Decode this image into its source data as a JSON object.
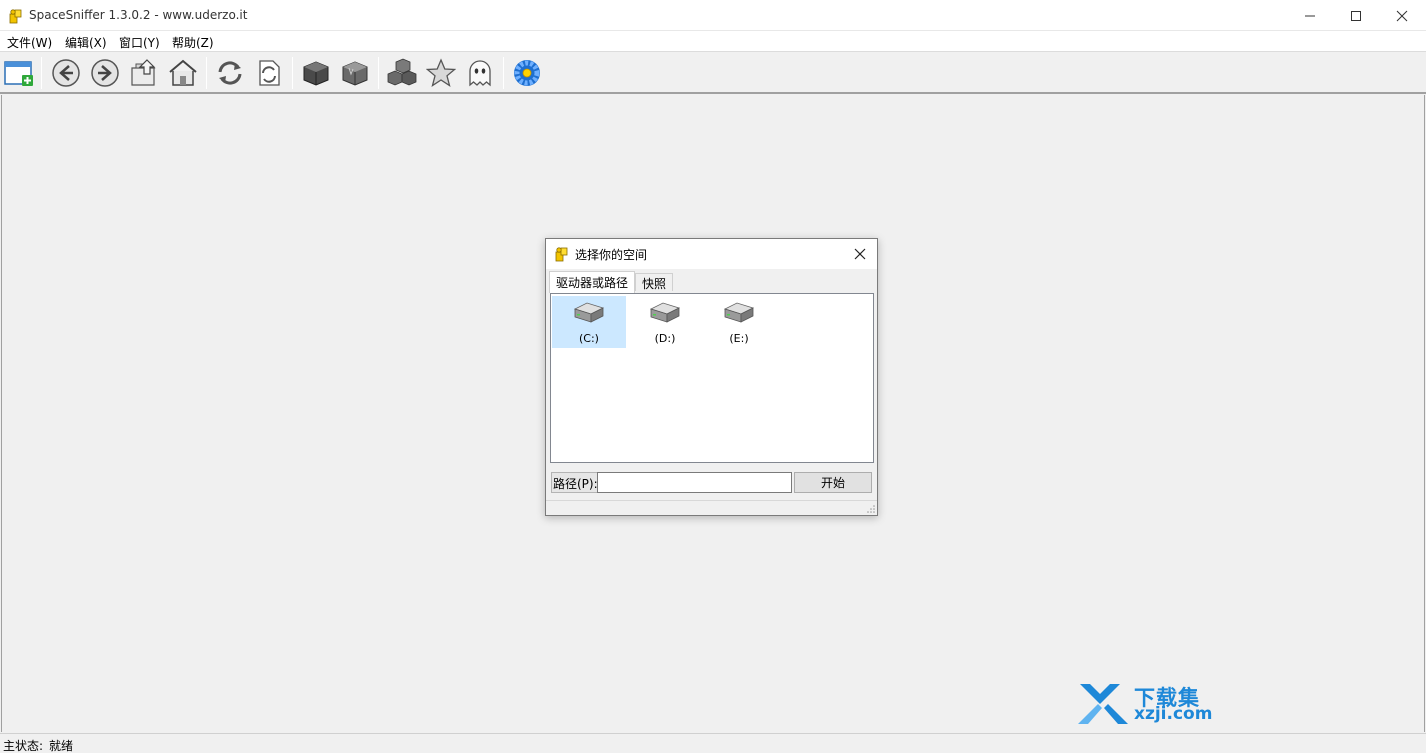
{
  "window": {
    "title": "SpaceSniffer 1.3.0.2 - www.uderzo.it",
    "min_glyph": "—",
    "close_glyph": "✕"
  },
  "menu": [
    {
      "label": "文件(W)"
    },
    {
      "label": "编辑(X)"
    },
    {
      "label": "窗口(Y)"
    },
    {
      "label": "帮助(Z)"
    }
  ],
  "toolbar": {
    "buttons": [
      {
        "icon": "new-window-icon"
      },
      {
        "icon": "back-arrow-icon"
      },
      {
        "icon": "forward-arrow-icon"
      },
      {
        "icon": "up-folder-icon"
      },
      {
        "icon": "home-icon"
      },
      {
        "icon": "refresh-icon"
      },
      {
        "icon": "refresh-document-icon"
      },
      {
        "icon": "dark-cube-icon"
      },
      {
        "icon": "cube-icon"
      },
      {
        "icon": "cubes-icon"
      },
      {
        "icon": "star-icon"
      },
      {
        "icon": "ghost-icon"
      },
      {
        "icon": "flower-icon"
      }
    ]
  },
  "status": {
    "label": "主状态:",
    "value": "就绪"
  },
  "dialog": {
    "title": "选择你的空间",
    "tabs": [
      {
        "label": "驱动器或路径",
        "active": true
      },
      {
        "label": "快照",
        "active": false
      }
    ],
    "drives": [
      {
        "label": "(C:)",
        "selected": true
      },
      {
        "label": "(D:)",
        "selected": false
      },
      {
        "label": "(E:)",
        "selected": false
      }
    ],
    "path_label": "路径(P):",
    "path_value": "",
    "start_label": "开始"
  },
  "watermark": {
    "line1": "下载集",
    "line2": "xzji.com"
  },
  "colors": {
    "accent": "#1e88d8",
    "selection": "#cce8ff"
  }
}
